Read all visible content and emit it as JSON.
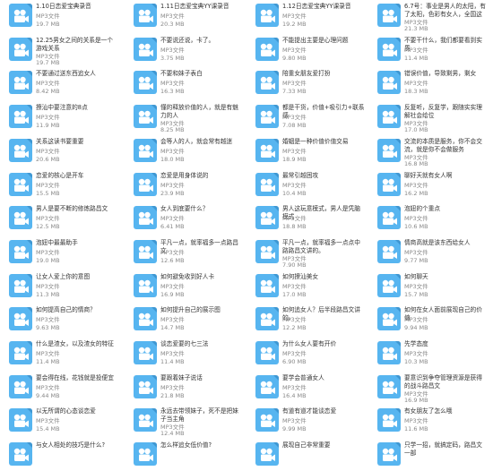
{
  "file_icon": "video-file-icon",
  "files": [
    {
      "name": "1.10日恋爱宝典录音",
      "type": "MP3文件",
      "size": "19.7 MB"
    },
    {
      "name": "1.11日恋爱宝典YY课录音",
      "type": "MP3文件",
      "size": "20.3 MB"
    },
    {
      "name": "1.12日恋爱宝典YY课录音",
      "type": "MP3文件",
      "size": "19.2 MB"
    },
    {
      "name": "6.7号：事业是男人的太阳，有了太阳，色彩有女人，全国这事业，…",
      "type": "MP3文件",
      "size": "21.3 MB"
    },
    {
      "name": "12.25男女之间的关系是一个游戏关系",
      "type": "MP3文件",
      "size": "19.7 MB"
    },
    {
      "name": "不要说还说，卡了。",
      "type": "MP3文件",
      "size": "3.75 MB"
    },
    {
      "name": "不能提出主要是心理问题",
      "type": "MP3文件",
      "size": "9.80 MB"
    },
    {
      "name": "不要干什么，我们都要看到实质",
      "type": "MP3文件",
      "size": "11.4 MB"
    },
    {
      "name": "不要通过送东西追女人",
      "type": "MP3文件",
      "size": "8.42 MB"
    },
    {
      "name": "不要和妹子表白",
      "type": "MP3文件",
      "size": "16.3 MB"
    },
    {
      "name": "陪重女朋友爱打扮",
      "type": "MP3文件",
      "size": "7.33 MB"
    },
    {
      "name": "错误价值，导致剩男，剩女",
      "type": "MP3文件",
      "size": "18.3 MB"
    },
    {
      "name": "撩汕中要注意的8点",
      "type": "MP3文件",
      "size": "11.9 MB"
    },
    {
      "name": "懂的释放价值的人，就是有魅力的人",
      "type": "MP3文件",
      "size": "8.25 MB"
    },
    {
      "name": "都是干货，价值+吸引力+联系感",
      "type": "MP3文件",
      "size": "7.08 MB"
    },
    {
      "name": "反复听，反复学，跟随实实理解社会给位",
      "type": "MP3文件",
      "size": "17.0 MB"
    },
    {
      "name": "关系这读书要重要",
      "type": "MP3文件",
      "size": "20.6 MB"
    },
    {
      "name": "会等人的人，就会常有越迷",
      "type": "MP3文件",
      "size": "18.0 MB"
    },
    {
      "name": "婚姻是一种价值价值交易",
      "type": "MP3文件",
      "size": "18.9 MB"
    },
    {
      "name": "交流的本质是服务，你不会交流，就是你不会做服务",
      "type": "MP3文件",
      "size": "16.8 MB"
    },
    {
      "name": "恋爱的核心是开车",
      "type": "MP3文件",
      "size": "15.5 MB"
    },
    {
      "name": "恋爱是用身体说的",
      "type": "MP3文件",
      "size": "23.9 MB"
    },
    {
      "name": "最常引越困攻",
      "type": "MP3文件",
      "size": "10.4 MB"
    },
    {
      "name": "聊好天就有女人啊",
      "type": "MP3文件",
      "size": "16.2 MB"
    },
    {
      "name": "男人是要不断的修炼路昌文",
      "type": "MP3文件",
      "size": "12.5 MB"
    },
    {
      "name": "女人到底要什么？",
      "type": "MP3文件",
      "size": "6.41 MB"
    },
    {
      "name": "男人这玩意模式，男人是凭脑模式",
      "type": "MP3文件",
      "size": "18.8 MB"
    },
    {
      "name": "泡妞的个重点",
      "type": "MP3文件",
      "size": "10.6 MB"
    },
    {
      "name": "泡妞中最最助手",
      "type": "MP3文件",
      "size": "19.0 MB"
    },
    {
      "name": "平凡一点，就率福多一点路昌文",
      "type": "MP3文件",
      "size": "12.6 MB"
    },
    {
      "name": "平凡一点，就率福多一点点中路路昌文讲的。",
      "type": "MP3文件",
      "size": "7.90 MB"
    },
    {
      "name": "情商高就是该东西给女人",
      "type": "MP3文件",
      "size": "9.77 MB"
    },
    {
      "name": "让女人爱上你的意图",
      "type": "MP3文件",
      "size": "11.3 MB"
    },
    {
      "name": "如何避免收到好人卡",
      "type": "MP3文件",
      "size": "16.9 MB"
    },
    {
      "name": "如何撩汕美女",
      "type": "MP3文件",
      "size": "17.0 MB"
    },
    {
      "name": "如何聊天",
      "type": "MP3文件",
      "size": "15.7 MB"
    },
    {
      "name": "如何提高自己的情商？",
      "type": "MP3文件",
      "size": "9.63 MB"
    },
    {
      "name": "如何提升自己的展示图",
      "type": "MP3文件",
      "size": "14.7 MB"
    },
    {
      "name": "如何追女人？后半段路昌文讲的。",
      "type": "MP3文件",
      "size": "12.2 MB"
    },
    {
      "name": "如何在女人面前展现自己的价值",
      "type": "MP3文件",
      "size": "9.94 MB"
    },
    {
      "name": "什么是渣女，以及渣女的特征",
      "type": "MP3文件",
      "size": "11.4 MB"
    },
    {
      "name": "谈恋爱要的七三法",
      "type": "MP3文件",
      "size": "11.4 MB"
    },
    {
      "name": "为什么女人要有开价",
      "type": "MP3文件",
      "size": "6.90 MB"
    },
    {
      "name": "先学态度",
      "type": "MP3文件",
      "size": "10.3 MB"
    },
    {
      "name": "要会得在线，花钱就是投便宜",
      "type": "MP3文件",
      "size": "9.44 MB"
    },
    {
      "name": "要跟着妹子说话",
      "type": "MP3文件",
      "size": "21.8 MB"
    },
    {
      "name": "要学会普通女人",
      "type": "MP3文件",
      "size": "16.4 MB"
    },
    {
      "name": "要意识到争夺管理资源是获得的战斗路昌文",
      "type": "MP3文件",
      "size": "16.9 MB"
    },
    {
      "name": "以无所谓的心态谈恋爱",
      "type": "MP3文件",
      "size": "15.4 MB"
    },
    {
      "name": "永远去带领妹子，死不是把妹子当主角",
      "type": "MP3文件",
      "size": "12.4 MB"
    },
    {
      "name": "有道有道才能谈恋爱",
      "type": "MP3文件",
      "size": "9.99 MB"
    },
    {
      "name": "有女朋友了怎么哦",
      "type": "MP3文件",
      "size": "11.6 MB"
    },
    {
      "name": "与女人相处的技巧是什么?",
      "type": "",
      "size": ""
    },
    {
      "name": "怎么样追女低价值?",
      "type": "",
      "size": ""
    },
    {
      "name": "展现自己非常重要",
      "type": "",
      "size": ""
    },
    {
      "name": "只学一招，就搞定码，路昌文一部",
      "type": "",
      "size": ""
    }
  ]
}
